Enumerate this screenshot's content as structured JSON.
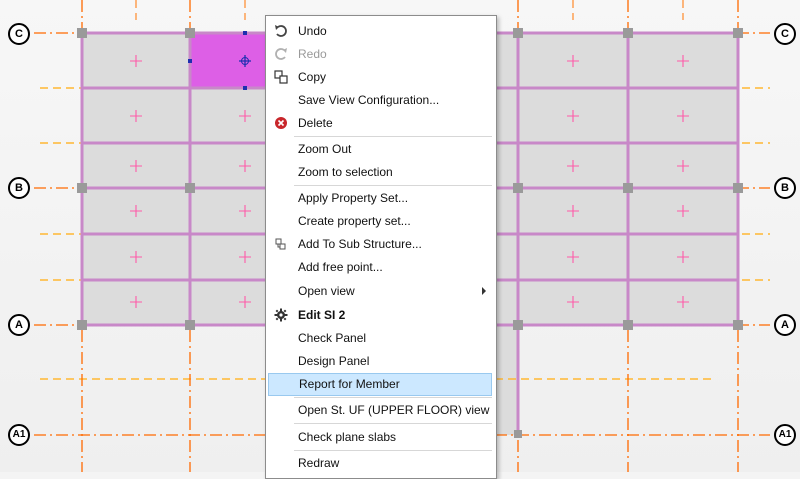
{
  "grid": {
    "axis_labels": {
      "c": "C",
      "b": "B",
      "a": "A",
      "a1": "A1"
    }
  },
  "colors": {
    "grid_line": "#ff6a00",
    "dashed_line": "#ffb733",
    "beam": "#c888c8",
    "panel": "#dcdcdc",
    "selected_panel": "#dd5fe6",
    "menu_highlight": "#cce8ff"
  },
  "context_menu": {
    "items": [
      {
        "id": "undo",
        "label": "Undo",
        "icon": "undo-icon"
      },
      {
        "id": "redo",
        "label": "Redo",
        "icon": "redo-icon",
        "disabled": true
      },
      {
        "id": "copy",
        "label": "Copy",
        "icon": "copy-icon"
      },
      {
        "id": "save-view",
        "label": "Save View Configuration..."
      },
      {
        "id": "delete",
        "label": "Delete",
        "icon": "delete-icon"
      },
      {
        "id": "zoom-out",
        "label": "Zoom Out"
      },
      {
        "id": "zoom-selection",
        "label": "Zoom to selection"
      },
      {
        "id": "apply-property",
        "label": "Apply Property Set..."
      },
      {
        "id": "create-property",
        "label": "Create property set..."
      },
      {
        "id": "add-sub",
        "label": "Add To Sub Structure...",
        "icon": "substructure-icon"
      },
      {
        "id": "add-free-point",
        "label": "Add free point..."
      },
      {
        "id": "open-view",
        "label": "Open view",
        "submenu": true
      },
      {
        "id": "edit-si",
        "label": "Edit SI 2",
        "icon": "gear-icon",
        "bold": true
      },
      {
        "id": "check-panel",
        "label": "Check Panel"
      },
      {
        "id": "design-panel",
        "label": "Design Panel"
      },
      {
        "id": "report-member",
        "label": "Report for Member",
        "highlighted": true
      },
      {
        "id": "open-st-uf",
        "label": "Open St. UF (UPPER FLOOR) view"
      },
      {
        "id": "check-plane",
        "label": "Check plane slabs"
      },
      {
        "id": "redraw",
        "label": "Redraw"
      }
    ]
  }
}
